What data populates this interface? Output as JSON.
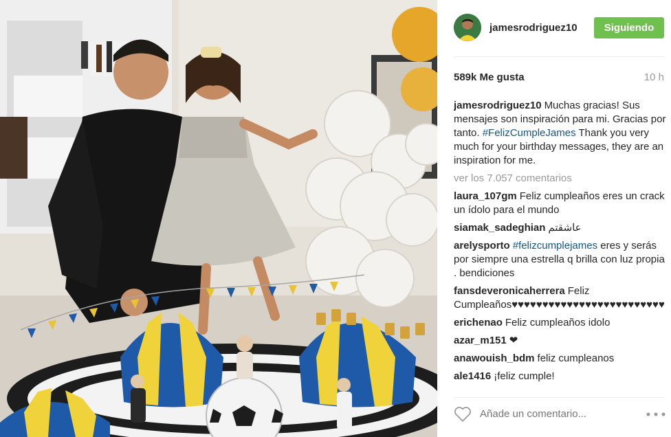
{
  "post": {
    "username": "jamesrodriguez10",
    "follow_label": "Siguiendo",
    "likes": "589k Me gusta",
    "time": "10 h"
  },
  "caption": {
    "username": "jamesrodriguez10",
    "text_before": "Muchas gracias! Sus mensajes son inspiración para mi. Gracias por tanto.",
    "hashtag": "#FelizCumpleJames",
    "text_after": "Thank you very much for your birthday messages, they are an inspiration for me."
  },
  "view_all": "ver los 7.057 comentarios",
  "comments": [
    {
      "user": "laura_107gm",
      "text": "Feliz cumpleaños eres un crack un ídolo para el mundo",
      "hashtag": ""
    },
    {
      "user": "siamak_sadeghian",
      "text": "عاشقتم",
      "hashtag": ""
    },
    {
      "user": "arelysporto",
      "hashtag": "#felizcumplejames",
      "text": "eres y serás por siempre una estrella q brilla con luz propia . bendiciones"
    },
    {
      "user": "fansdeveronicaherrera",
      "text": "Feliz Cumpleaños♥♥♥♥♥♥♥♥♥♥♥♥♥♥♥♥♥♥♥♥♥♥♥♥♥",
      "hashtag": ""
    },
    {
      "user": "erichenao",
      "text": "Feliz cumpleaños idolo",
      "hashtag": ""
    },
    {
      "user": "azar_m151",
      "text": "❤",
      "hashtag": ""
    },
    {
      "user": "anawouish_bdm",
      "text": "feliz cumpleanos",
      "hashtag": ""
    },
    {
      "user": "ale1416",
      "text": "¡feliz cumple!",
      "hashtag": ""
    }
  ],
  "add_comment_placeholder": "Añade un comentario...",
  "colors": {
    "follow_green": "#70c050",
    "hashtag_blue": "#125688",
    "muted": "#999999"
  },
  "icons": {
    "like": "heart-outline-icon",
    "options": "more-options-icon"
  }
}
